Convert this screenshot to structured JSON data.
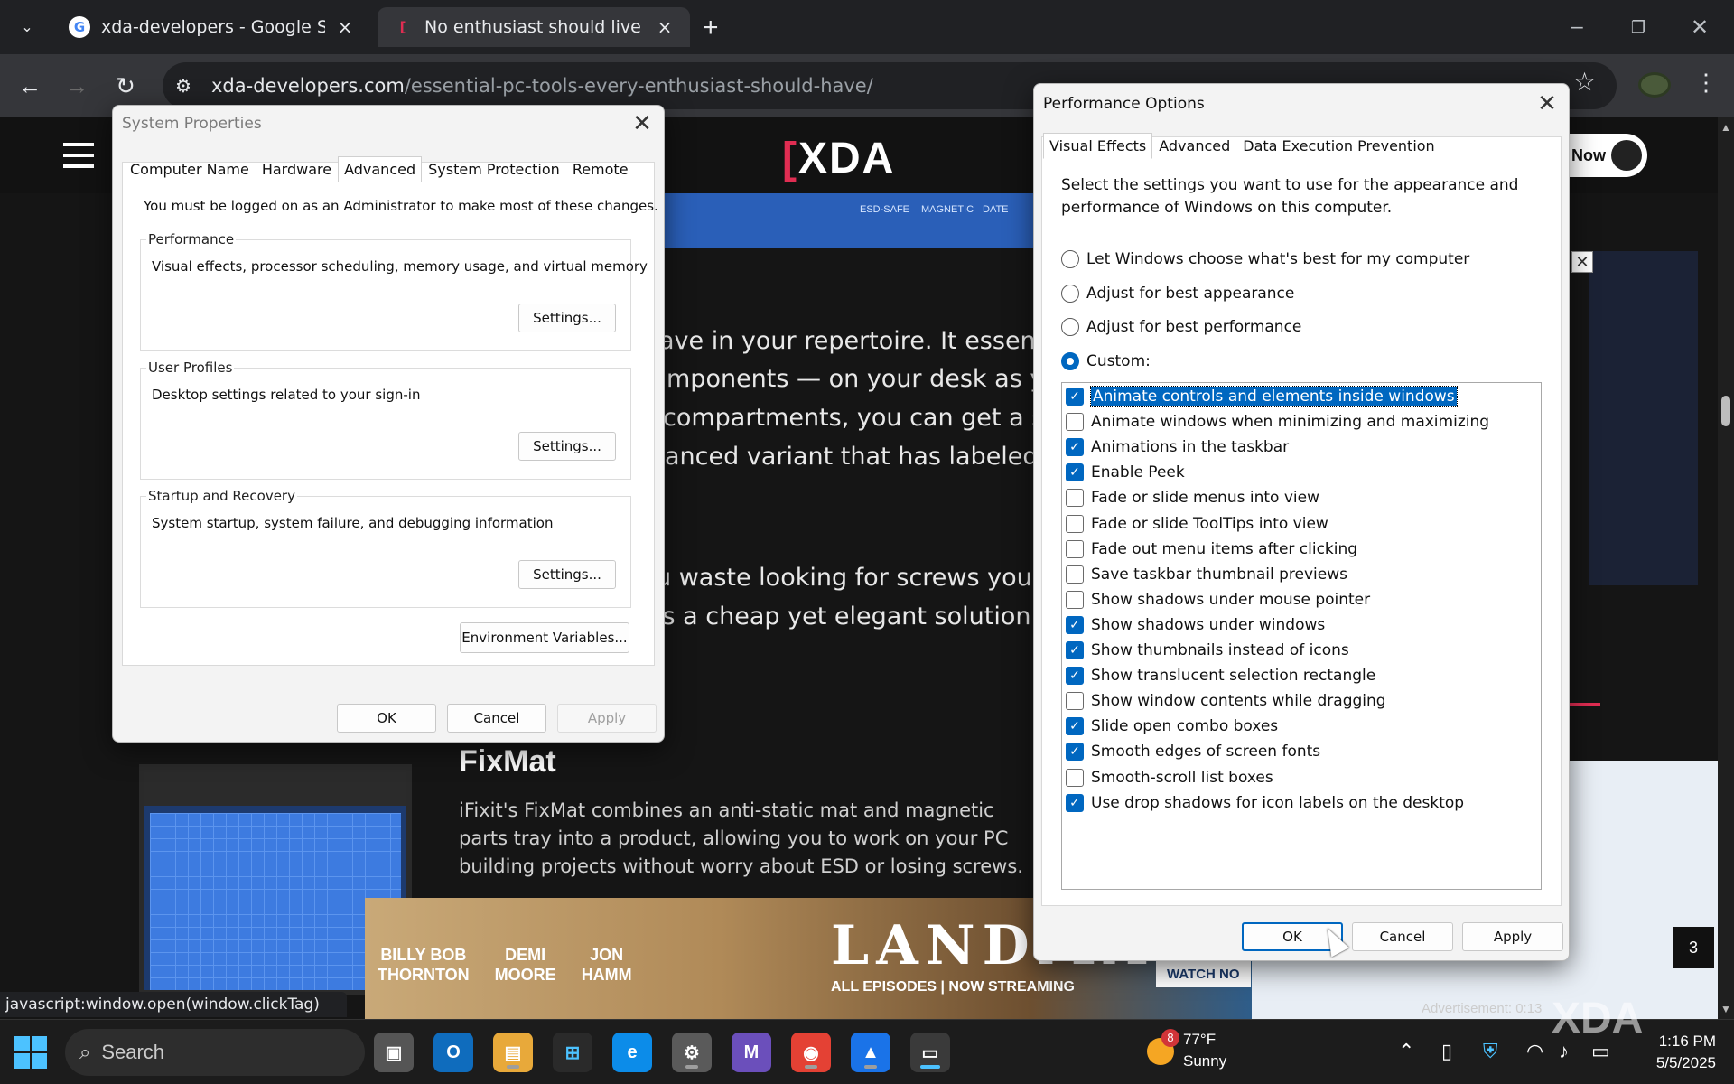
{
  "browser": {
    "tabs": [
      {
        "title": "xda-developers - Google Search",
        "close": "×"
      },
      {
        "title": "No enthusiast should live with w",
        "close": "×"
      }
    ],
    "new_tab": "+",
    "url_domain": "xda-developers.com",
    "url_path": "/essential-pc-tools-every-enthusiast-should-have/",
    "status_url": "javascript:window.open(window.clickTag)"
  },
  "page": {
    "logo": "XDA",
    "now_button": "Now",
    "lines": [
      "ave in your repertoire. It essentially k",
      "mponents — on your desk as you w",
      "compartments, you can get a small r",
      "anced variant that has labeled sectio",
      "u waste looking for screws you lose",
      "is a cheap yet elegant solution to all"
    ],
    "fixmat_title": "FixMat",
    "fixmat_text": "iFixit's FixMat combines an anti-static mat and magnetic parts tray into a product, allowing you to work on your PC building projects without worry about ESD or losing screws.",
    "ruler_labels": [
      "ESD-SAFE",
      "MAGNETIC",
      "DATE"
    ],
    "ad": {
      "actors": [
        [
          "BILLY BOB",
          "THORNTON"
        ],
        [
          "DEMI",
          "MOORE"
        ],
        [
          "JON",
          "HAMM"
        ]
      ],
      "title": "LANDMA",
      "sub": "ALL EPISODES | NOW STREAMING",
      "watch": "WATCH NO"
    },
    "ad_label": "Advertisement: 0:13",
    "count_badge": "3"
  },
  "sysprops": {
    "title": "System Properties",
    "tabs": [
      "Computer Name",
      "Hardware",
      "Advanced",
      "System Protection",
      "Remote"
    ],
    "note": "You must be logged on as an Administrator to make most of these changes.",
    "performance": {
      "legend": "Performance",
      "desc": "Visual effects, processor scheduling, memory usage, and virtual memory",
      "button": "Settings..."
    },
    "user_profiles": {
      "legend": "User Profiles",
      "desc": "Desktop settings related to your sign-in",
      "button": "Settings..."
    },
    "startup": {
      "legend": "Startup and Recovery",
      "desc": "System startup, system failure, and debugging information",
      "button": "Settings..."
    },
    "env_button": "Environment Variables...",
    "ok": "OK",
    "cancel": "Cancel",
    "apply": "Apply"
  },
  "perf": {
    "title": "Performance Options",
    "tabs": [
      "Visual Effects",
      "Advanced",
      "Data Execution Prevention"
    ],
    "intro": "Select the settings you want to use for the appearance and performance of Windows on this computer.",
    "radios": [
      {
        "label": "Let Windows choose what's best for my computer",
        "checked": false
      },
      {
        "label": "Adjust for best appearance",
        "checked": false
      },
      {
        "label": "Adjust for best performance",
        "checked": false
      },
      {
        "label": "Custom:",
        "checked": true
      }
    ],
    "effects": [
      {
        "label": "Animate controls and elements inside windows",
        "checked": true
      },
      {
        "label": "Animate windows when minimizing and maximizing",
        "checked": false
      },
      {
        "label": "Animations in the taskbar",
        "checked": true
      },
      {
        "label": "Enable Peek",
        "checked": true
      },
      {
        "label": "Fade or slide menus into view",
        "checked": false
      },
      {
        "label": "Fade or slide ToolTips into view",
        "checked": false
      },
      {
        "label": "Fade out menu items after clicking",
        "checked": false
      },
      {
        "label": "Save taskbar thumbnail previews",
        "checked": false
      },
      {
        "label": "Show shadows under mouse pointer",
        "checked": false
      },
      {
        "label": "Show shadows under windows",
        "checked": true
      },
      {
        "label": "Show thumbnails instead of icons",
        "checked": true
      },
      {
        "label": "Show translucent selection rectangle",
        "checked": true
      },
      {
        "label": "Show window contents while dragging",
        "checked": false
      },
      {
        "label": "Slide open combo boxes",
        "checked": true
      },
      {
        "label": "Smooth edges of screen fonts",
        "checked": true
      },
      {
        "label": "Smooth-scroll list boxes",
        "checked": false
      },
      {
        "label": "Use drop shadows for icon labels on the desktop",
        "checked": true
      }
    ],
    "ok": "OK",
    "cancel": "Cancel",
    "apply": "Apply"
  },
  "taskbar": {
    "search_placeholder": "Search",
    "weather_temp": "77°F",
    "weather_desc": "Sunny",
    "weather_badge": "8",
    "time": "1:16 PM",
    "date": "5/5/2025",
    "watermark": "XDA"
  }
}
